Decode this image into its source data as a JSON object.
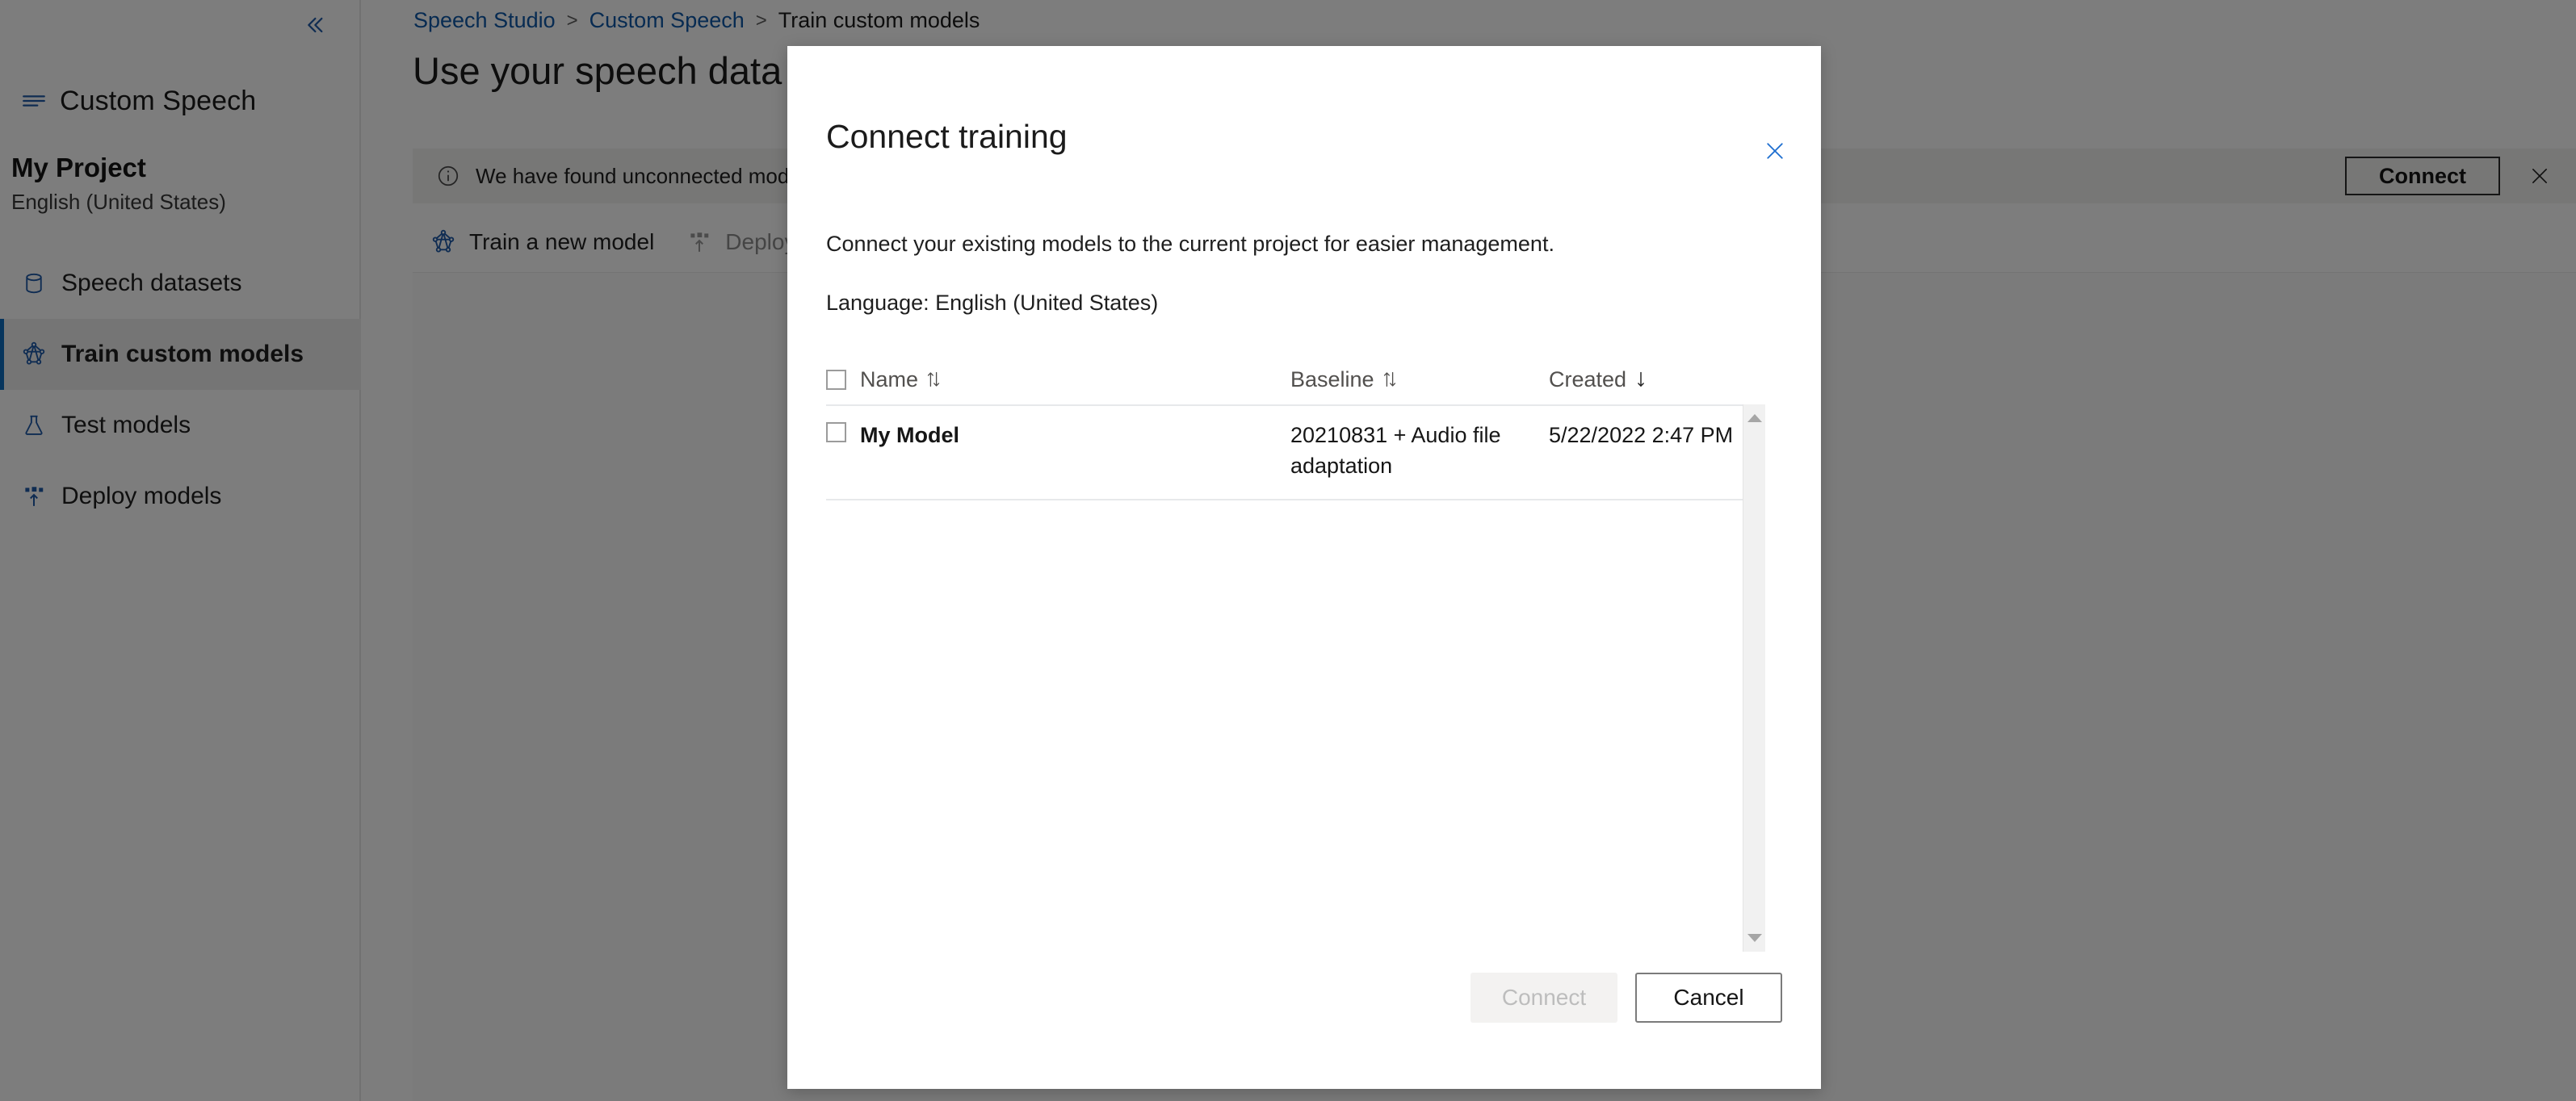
{
  "colors": {
    "accent": "#1f5aa8",
    "link": "#1059a8",
    "selected_bar": "#0f6cbd",
    "notice_bg": "#f3f2f1",
    "overlay": "rgba(0,0,0,0.51)",
    "modal_close": "#1f6fd0"
  },
  "sidebar": {
    "collapse_icon": "chevron-double-left-icon",
    "workspace_icon": "menu-lines-icon",
    "workspace_label": "Custom Speech",
    "project_name": "My Project",
    "project_locale": "English (United States)",
    "items": [
      {
        "icon": "database-icon",
        "label": "Speech datasets",
        "selected": false
      },
      {
        "icon": "model-graph-icon",
        "label": "Train custom models",
        "selected": true
      },
      {
        "icon": "flask-icon",
        "label": "Test models",
        "selected": false
      },
      {
        "icon": "deploy-upload-icon",
        "label": "Deploy models",
        "selected": false
      }
    ]
  },
  "main": {
    "breadcrumb": [
      {
        "label": "Speech Studio",
        "current": false
      },
      {
        "label": "Custom Speech",
        "current": false
      },
      {
        "label": "Train custom models",
        "current": true
      }
    ],
    "breadcrumb_separator": ">",
    "page_title": "Use your speech data",
    "notice": {
      "icon": "info-circle-icon",
      "text": "We have found unconnected models … want to connect these entities to this project so you can …",
      "button_label": "Connect",
      "close_icon": "close-icon"
    },
    "toolbar": [
      {
        "icon": "model-graph-icon",
        "label": "Train a new model",
        "disabled": false
      },
      {
        "icon": "deploy-upload-icon",
        "label": "Deploy",
        "disabled": true
      }
    ]
  },
  "modal": {
    "title": "Connect training",
    "close_icon": "close-icon",
    "description": "Connect your existing models to the current project for easier management.",
    "language_line": "Language: English (United States)",
    "table": {
      "select_all_checkbox": false,
      "columns": [
        {
          "key": "name",
          "label": "Name",
          "sort_icon": "sort-both-icon"
        },
        {
          "key": "baseline",
          "label": "Baseline",
          "sort_icon": "sort-both-icon"
        },
        {
          "key": "created",
          "label": "Created",
          "sort_icon": "sort-desc-icon"
        }
      ],
      "rows": [
        {
          "checked": false,
          "name": "My Model",
          "baseline": "20210831 + Audio file adaptation",
          "created": "5/22/2022 2:47 PM"
        }
      ],
      "scrollbar": {
        "up_icon": "caret-up-icon",
        "down_icon": "caret-down-icon"
      }
    },
    "footer": {
      "connect_label": "Connect",
      "connect_disabled": true,
      "cancel_label": "Cancel"
    }
  }
}
